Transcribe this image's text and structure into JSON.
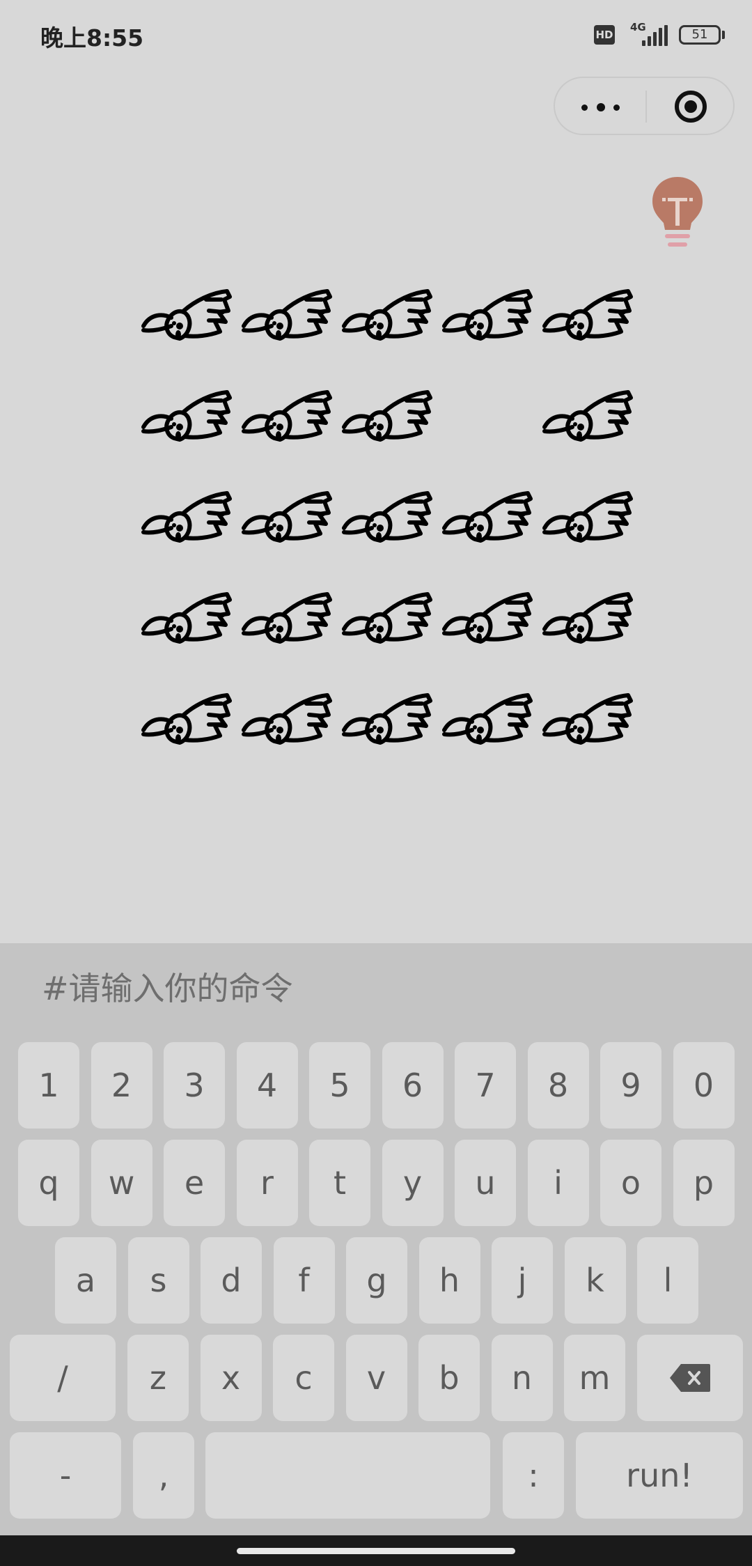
{
  "status_bar": {
    "time": "晚上8:55",
    "hd_label": "HD",
    "network": "4G",
    "battery": "51"
  },
  "capsule": {
    "more_icon": "more-dots-icon",
    "close_icon": "target-close-icon"
  },
  "hint": {
    "icon": "lightbulb-icon",
    "color": "#b97a66"
  },
  "board": {
    "rows": 5,
    "cols": 5,
    "empty_cells": [
      [
        1,
        3
      ]
    ],
    "piece_icon": "bunny-icon"
  },
  "command": {
    "placeholder": "#请输入你的命令"
  },
  "keyboard": {
    "row1": [
      "1",
      "2",
      "3",
      "4",
      "5",
      "6",
      "7",
      "8",
      "9",
      "0"
    ],
    "row2": [
      "q",
      "w",
      "e",
      "r",
      "t",
      "y",
      "u",
      "i",
      "o",
      "p"
    ],
    "row3": [
      "a",
      "s",
      "d",
      "f",
      "g",
      "h",
      "j",
      "k",
      "l"
    ],
    "row4": [
      "/",
      "z",
      "x",
      "c",
      "v",
      "b",
      "n",
      "m"
    ],
    "row5": [
      "-",
      ",",
      "",
      ":",
      "run!"
    ],
    "backspace_icon": "backspace-icon"
  }
}
